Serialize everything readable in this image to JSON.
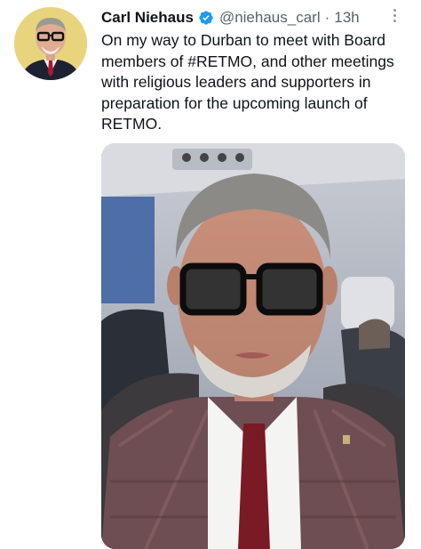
{
  "tweet": {
    "author_name": "Carl Niehaus",
    "handle": "@niehaus_carl",
    "separator": "·",
    "time": "13h",
    "text": "On my way to Durban to meet with Board\nmembers of #RETMO, and other meetings\nwith religious leaders and supporters in\npreparation for the upcoming launch of\nRETMO.",
    "verified_color": "#1d9bf0",
    "icons": {
      "verified": "verified-badge-icon",
      "more": "more-options-icon"
    }
  }
}
